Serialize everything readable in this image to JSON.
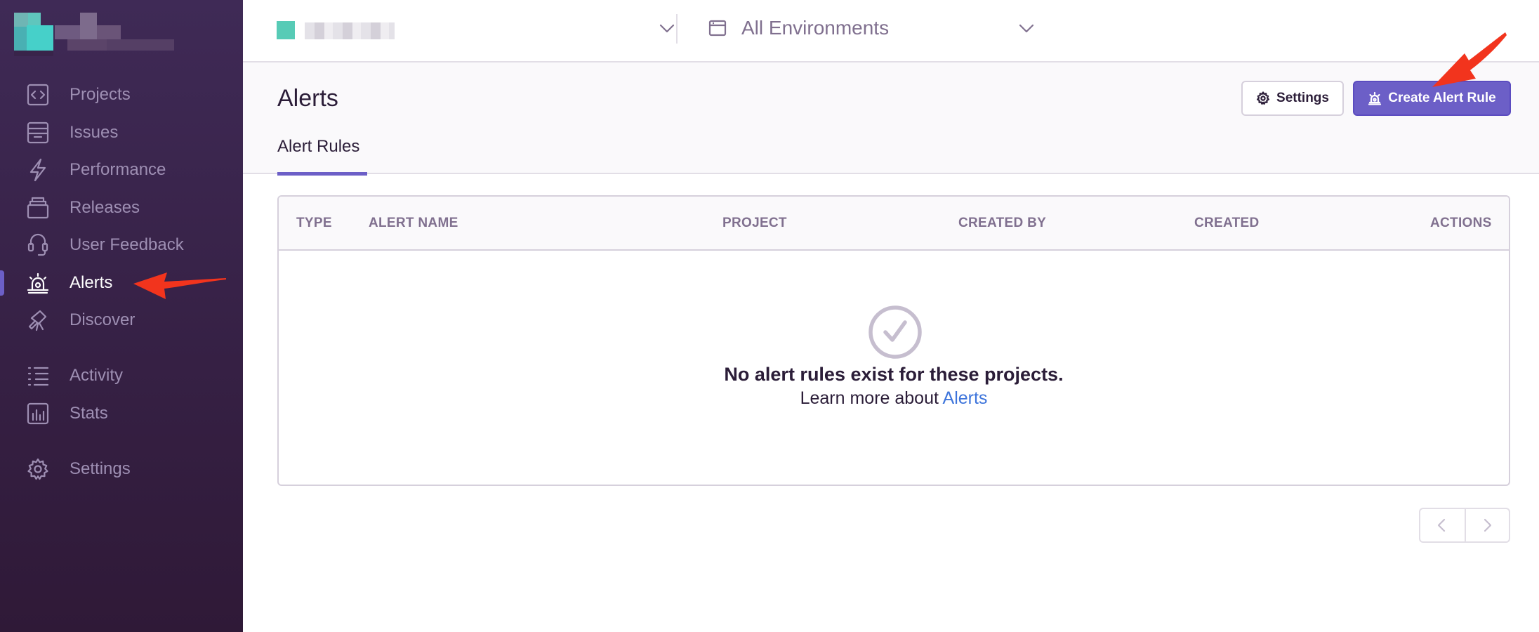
{
  "sidebar": {
    "items": [
      {
        "label": "Projects",
        "icon": "projects-icon"
      },
      {
        "label": "Issues",
        "icon": "issues-icon"
      },
      {
        "label": "Performance",
        "icon": "performance-icon"
      },
      {
        "label": "Releases",
        "icon": "releases-icon"
      },
      {
        "label": "User Feedback",
        "icon": "user-feedback-icon"
      },
      {
        "label": "Alerts",
        "icon": "alerts-icon",
        "active": true
      },
      {
        "label": "Discover",
        "icon": "discover-icon"
      },
      {
        "label": "Activity",
        "icon": "activity-icon"
      },
      {
        "label": "Stats",
        "icon": "stats-icon"
      },
      {
        "label": "Settings",
        "icon": "settings-icon"
      }
    ]
  },
  "header": {
    "environment_label": "All Environments"
  },
  "page": {
    "title": "Alerts",
    "settings_button": "Settings",
    "create_button": "Create Alert Rule",
    "tab_label": "Alert Rules"
  },
  "table": {
    "columns": [
      "TYPE",
      "ALERT NAME",
      "PROJECT",
      "CREATED BY",
      "CREATED",
      "ACTIONS"
    ],
    "empty_title": "No alert rules exist for these projects.",
    "empty_sub_prefix": "Learn more about",
    "empty_sub_link": "Alerts"
  },
  "colors": {
    "sidebar_bg": "#3f2a56",
    "accent": "#6c5fc7",
    "link": "#3d74db",
    "annotation_arrow": "#f2341d"
  }
}
